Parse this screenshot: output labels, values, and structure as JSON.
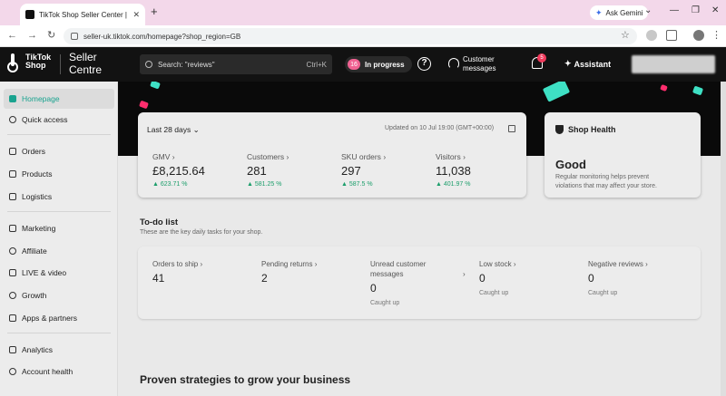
{
  "browser": {
    "tab_title": "TikTok Shop Seller Center | Uni",
    "url": "seller-uk.tiktok.com/homepage?shop_region=GB",
    "ask_gemini": "Ask Gemini"
  },
  "topbar": {
    "brand": "TikTok Shop",
    "product": "Seller Centre",
    "search_placeholder": "Search: \"reviews\"",
    "search_shortcut": "Ctrl+K",
    "in_progress_count": "16",
    "in_progress_label": "In progress",
    "customer_messages": "Customer messages",
    "notification_count": "5",
    "assistant": "Assistant"
  },
  "sidebar": {
    "items": [
      {
        "label": "Homepage"
      },
      {
        "label": "Quick access"
      },
      {
        "label": "Orders"
      },
      {
        "label": "Products"
      },
      {
        "label": "Logistics"
      },
      {
        "label": "Marketing"
      },
      {
        "label": "Affiliate"
      },
      {
        "label": "LIVE & video"
      },
      {
        "label": "Growth"
      },
      {
        "label": "Apps & partners"
      },
      {
        "label": "Analytics"
      },
      {
        "label": "Account health"
      }
    ]
  },
  "stats": {
    "period": "Last 28 days",
    "updated": "Updated on 10 Jul 19:00 (GMT+00:00)",
    "metrics": [
      {
        "label": "GMV",
        "value": "£8,215.64",
        "change": "623.71 %"
      },
      {
        "label": "Customers",
        "value": "281",
        "change": "581.25 %"
      },
      {
        "label": "SKU orders",
        "value": "297",
        "change": "587.5 %"
      },
      {
        "label": "Visitors",
        "value": "11,038",
        "change": "401.97 %"
      }
    ]
  },
  "health": {
    "title": "Shop Health",
    "status": "Good",
    "description": "Regular monitoring helps prevent violations that may affect your store."
  },
  "todo": {
    "title": "To-do list",
    "subtitle": "These are the key daily tasks for your shop.",
    "items": [
      {
        "label": "Orders to ship",
        "value": "41",
        "note": ""
      },
      {
        "label": "Pending returns",
        "value": "2",
        "note": ""
      },
      {
        "label": "Unread customer messages",
        "value": "0",
        "note": "Caught up"
      },
      {
        "label": "Low stock",
        "value": "0",
        "note": "Caught up"
      },
      {
        "label": "Negative reviews",
        "value": "0",
        "note": "Caught up"
      }
    ]
  },
  "strategies": {
    "title": "Proven strategies to grow your business"
  },
  "colors": {
    "accent": "#1aa38f",
    "positive": "#1c9e6b",
    "badge": "#f23a5c",
    "hero_teal": "#3ee0c4",
    "hero_pink": "#ff2d6d"
  }
}
